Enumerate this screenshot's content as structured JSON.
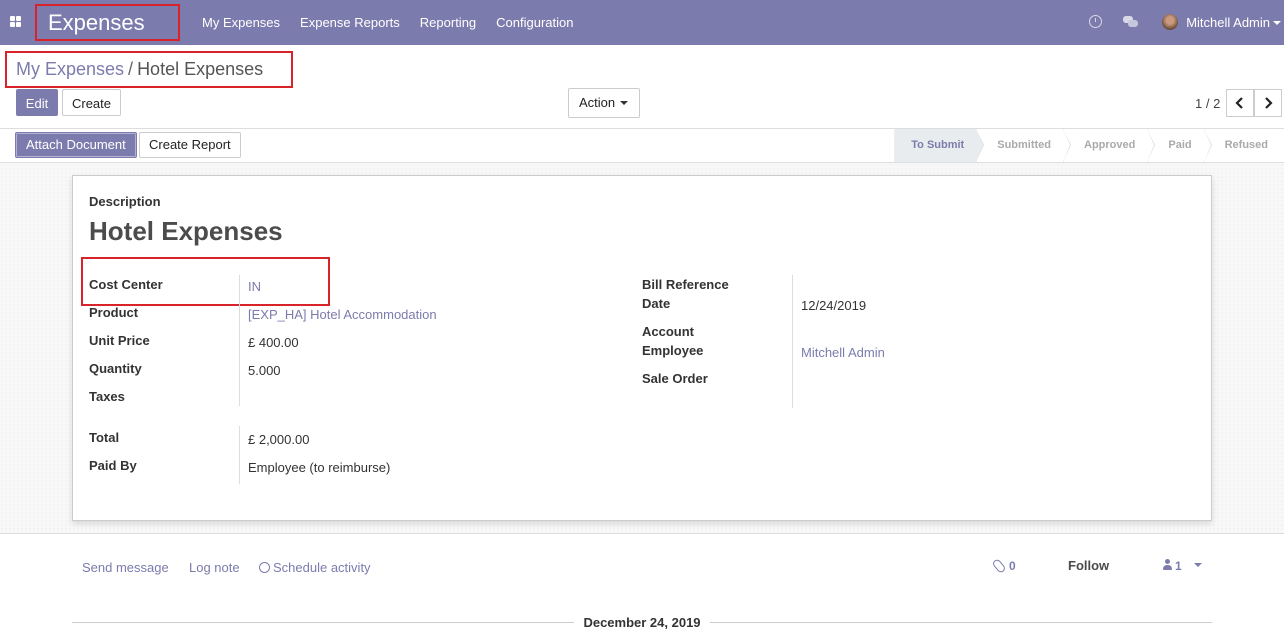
{
  "navbar": {
    "app_name": "Expenses",
    "menu": [
      "My Expenses",
      "Expense Reports",
      "Reporting",
      "Configuration"
    ],
    "user_name": "Mitchell Admin",
    "accent_color": "#7c7bad"
  },
  "breadcrumb": {
    "parent": "My Expenses",
    "separator": "/",
    "current": "Hotel Expenses"
  },
  "control_panel": {
    "edit_label": "Edit",
    "create_label": "Create",
    "action_label": "Action",
    "pager": "1 / 2"
  },
  "statusbar": {
    "attach_label": "Attach Document",
    "report_label": "Create Report",
    "stages": [
      "To Submit",
      "Submitted",
      "Approved",
      "Paid",
      "Refused"
    ],
    "active_stage": "To Submit"
  },
  "form": {
    "description_label": "Description",
    "title": "Hotel Expenses",
    "left_fields": [
      {
        "label": "Cost Center",
        "value": "IN",
        "link": true
      },
      {
        "label": "Product",
        "value": "[EXP_HA] Hotel Accommodation",
        "link": true
      },
      {
        "label": "Unit Price",
        "value": "£ 400.00",
        "link": false
      },
      {
        "label": "Quantity",
        "value": "5.000",
        "link": false
      },
      {
        "label": "Taxes",
        "value": "",
        "link": false
      }
    ],
    "total_label": "Total",
    "total_value": "£ 2,000.00",
    "paid_by_label": "Paid By",
    "paid_by_value": "Employee (to reimburse)",
    "right_fields": {
      "bill_reference_label": "Bill Reference",
      "date_label": "Date",
      "date_value": "12/24/2019",
      "account_label": "Account",
      "employee_label": "Employee",
      "employee_value": "Mitchell Admin",
      "sale_order_label": "Sale Order"
    }
  },
  "chatter": {
    "send_message": "Send message",
    "log_note": "Log note",
    "schedule_activity": "Schedule activity",
    "attachments_count": "0",
    "follow_label": "Follow",
    "followers_count": "1",
    "date_separator": "December 24, 2019"
  }
}
